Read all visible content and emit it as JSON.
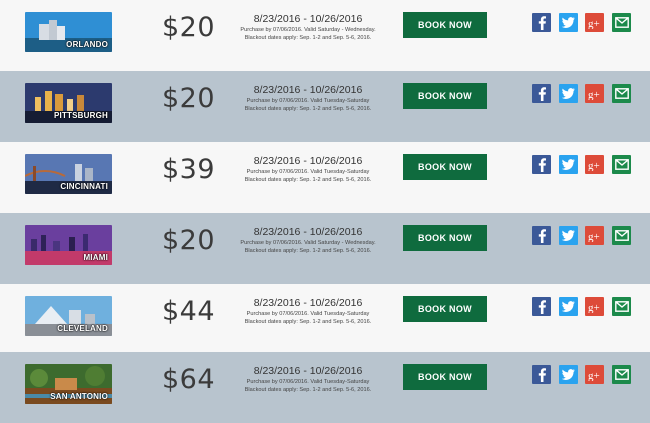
{
  "offers": [
    {
      "city": "ORLANDO",
      "price": "$20",
      "dates": "8/23/2016 - 10/26/2016",
      "terms": "Purchase by 07/06/2016. Valid Saturday - Wednesday. Blackout dates apply: Sep. 1-2 and Sep. 5-6, 2016.",
      "cta": "BOOK NOW",
      "thumb_sky": "#2f8fd4",
      "thumb_ground": "#1d5e86"
    },
    {
      "city": "PITTSBURGH",
      "price": "$20",
      "dates": "8/23/2016 - 10/26/2016",
      "terms": "Purchase by 07/06/2016. Valid Tuesday-Saturday Blackout dates apply: Sep. 1-2 and Sep. 5-6, 2016.",
      "cta": "BOOK NOW",
      "thumb_sky": "#2c3a6e",
      "thumb_ground": "#151c33"
    },
    {
      "city": "CINCINNATI",
      "price": "$39",
      "dates": "8/23/2016 - 10/26/2016",
      "terms": "Purchase by 07/06/2016. Valid Tuesday-Saturday Blackout dates apply: Sep. 1-2 and Sep. 5-6, 2016.",
      "cta": "BOOK NOW",
      "thumb_sky": "#5877b3",
      "thumb_ground": "#1f2a45"
    },
    {
      "city": "MIAMI",
      "price": "$20",
      "dates": "8/23/2016 - 10/26/2016",
      "terms": "Purchase by 07/06/2016. Valid Saturday - Wednesday. Blackout dates apply: Sep. 1-2 and Sep. 5-6, 2016.",
      "cta": "BOOK NOW",
      "thumb_sky": "#6a3f9e",
      "thumb_ground": "#c23a6a"
    },
    {
      "city": "CLEVELAND",
      "price": "$44",
      "dates": "8/23/2016 - 10/26/2016",
      "terms": "Purchase by 07/06/2016. Valid Tuesday-Saturday Blackout dates apply: Sep. 1-2 and Sep. 5-6, 2016.",
      "cta": "BOOK NOW",
      "thumb_sky": "#6fb0de",
      "thumb_ground": "#8a8f96"
    },
    {
      "city": "SAN ANTONIO",
      "price": "$64",
      "dates": "8/23/2016 - 10/26/2016",
      "terms": "Purchase by 07/06/2016. Valid Tuesday-Saturday Blackout dates apply: Sep. 1-2 and Sep. 5-6, 2016.",
      "cta": "BOOK NOW",
      "thumb_sky": "#3d6b2e",
      "thumb_ground": "#7a4a1f"
    }
  ],
  "share_icons": [
    "facebook-icon",
    "twitter-icon",
    "google-plus-icon",
    "email-icon"
  ],
  "colors": {
    "row_light": "#f7f7f7",
    "row_dark": "#b8c4ce",
    "book_button": "#0f6b3e",
    "facebook": "#3b5998",
    "twitter": "#2aa3ef",
    "google_plus": "#dd4b39",
    "email": "#1c8a4b"
  }
}
